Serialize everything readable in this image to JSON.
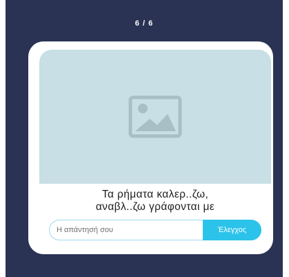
{
  "header": {
    "progress": "6 / 6"
  },
  "card": {
    "image": {
      "icon": "image-placeholder-icon"
    },
    "question": {
      "line1": "Τα ρήματα καλερ..ζω,",
      "line2": "αναβλ..ζω γράφονται με"
    },
    "answer": {
      "placeholder": "Η απάντησή σου",
      "value": ""
    },
    "check_button": {
      "label": "Έλεγχος"
    }
  },
  "colors": {
    "panel_background": "#2a3354",
    "card_background": "#ffffff",
    "image_background": "#c7dfe5",
    "accent": "#2cc3ea",
    "input_border": "#9fd9ee"
  }
}
